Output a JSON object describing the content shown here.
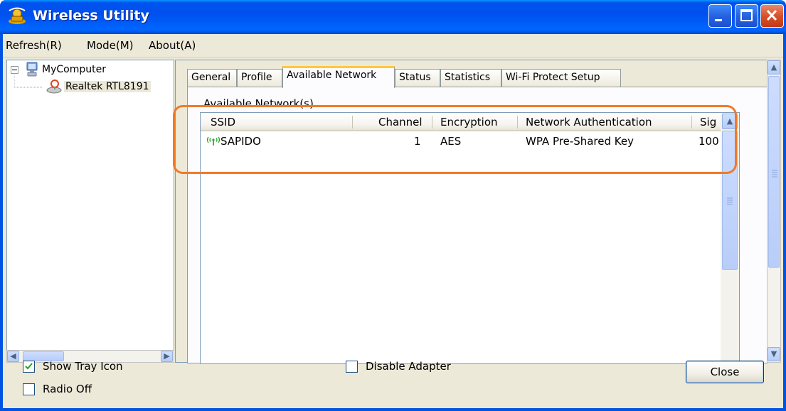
{
  "window": {
    "title": "Wireless Utility"
  },
  "menu": {
    "items": [
      "Refresh(R)",
      "Mode(M)",
      "About(A)"
    ]
  },
  "tree": {
    "root": "MyComputer",
    "child": "Realtek RTL8191"
  },
  "tabs": [
    {
      "label": "General"
    },
    {
      "label": "Profile"
    },
    {
      "label": "Available Network"
    },
    {
      "label": "Status"
    },
    {
      "label": "Statistics"
    },
    {
      "label": "Wi-Fi Protect Setup"
    }
  ],
  "active_tab": "Available Network",
  "available_networks": {
    "group_label": "Available Network(s)",
    "columns": [
      "SSID",
      "Channel",
      "Encryption",
      "Network Authentication",
      "Sig"
    ],
    "rows": [
      {
        "ssid": "SAPIDO",
        "channel": "1",
        "encryption": "AES",
        "auth": "WPA Pre-Shared Key",
        "signal": "100"
      }
    ]
  },
  "options": {
    "show_tray_icon": {
      "label": "Show Tray Icon",
      "checked": true
    },
    "radio_off": {
      "label": "Radio Off",
      "checked": false
    },
    "disable_adapter": {
      "label": "Disable Adapter",
      "checked": false
    }
  },
  "buttons": {
    "close": "Close"
  },
  "colors": {
    "titlebar": "#0054e3",
    "highlight": "#ef7a2a",
    "dialog_bg": "#ece9d8",
    "active_tab_accent": "#ffc83c"
  },
  "icons": {
    "app": "wireless-utility-icon",
    "computer": "computer-icon",
    "adapter": "network-adapter-icon",
    "signal": "signal-strength-icon"
  }
}
